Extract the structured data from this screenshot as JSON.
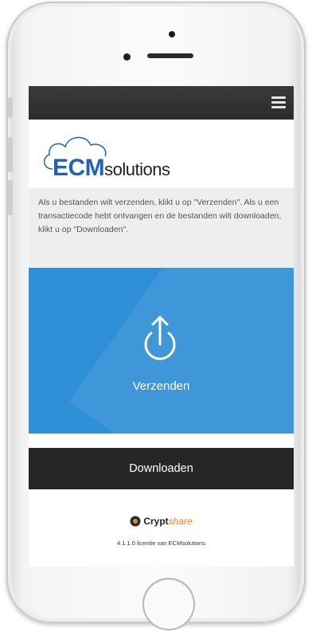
{
  "logo": {
    "primary": "ECM",
    "secondary": "solutions",
    "color": "#1f63b6"
  },
  "topbar": {
    "menu_icon": "hamburger-menu-icon"
  },
  "intro": {
    "text": "Als u bestanden wilt verzenden, klikt u op \"Verzenden\". Als u een transactiecode hebt ontvangen en de bestanden wilt downloaden, klikt u op \"Downloaden\"."
  },
  "send": {
    "label": "Verzenden",
    "icon": "upload-icon",
    "color": "#2f8fd7"
  },
  "download": {
    "label": "Downloaden",
    "color": "#262626"
  },
  "footer": {
    "brand_primary": "Crypt",
    "brand_secondary": "share",
    "license": "4.1.1.0 licentie van ECMsolutions"
  }
}
